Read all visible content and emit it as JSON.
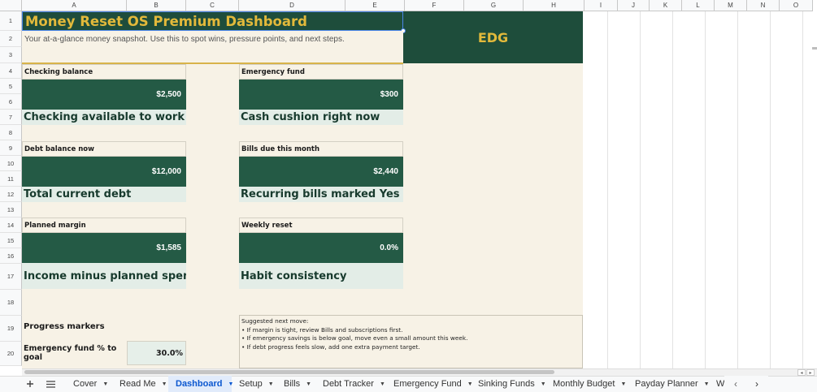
{
  "columns": [
    "A",
    "B",
    "C",
    "D",
    "E",
    "F",
    "G",
    "H",
    "I",
    "J",
    "K",
    "L",
    "M",
    "N",
    "O"
  ],
  "rows": [
    "1",
    "2",
    "3",
    "4",
    "5",
    "6",
    "7",
    "8",
    "9",
    "10",
    "11",
    "12",
    "13",
    "14",
    "15",
    "16",
    "17",
    "18",
    "19",
    "20"
  ],
  "header": {
    "title": "Money Reset OS Premium Dashboard",
    "subtitle": "Your at-a-glance money snapshot. Use this to spot wins, pressure points, and next steps.",
    "brand": "EDG"
  },
  "cards": [
    {
      "label": "Checking balance",
      "value": "$2,500",
      "caption": "Checking available to work with"
    },
    {
      "label": "Emergency fund",
      "value": "$300",
      "caption": "Cash cushion right now"
    },
    {
      "label": "Debt balance now",
      "value": "$12,000",
      "caption": "Total current debt"
    },
    {
      "label": "Bills due this month",
      "value": "$2,440",
      "caption": "Recurring bills marked Yes"
    },
    {
      "label": "Planned margin",
      "value": "$1,585",
      "caption": "Income minus planned spend"
    },
    {
      "label": "Weekly reset",
      "value": "0.0%",
      "caption": "Habit consistency"
    }
  ],
  "progress": {
    "heading": "Progress markers",
    "rows": [
      {
        "label": "Emergency fund % to goal",
        "value": "30.0%"
      }
    ]
  },
  "suggestion": {
    "heading": "Suggested next move:",
    "lines": [
      "• If margin is tight, review Bills and subscriptions first.",
      "• If emergency savings is below goal, move even a small amount this week.",
      "• If debt progress feels slow, add one extra payment target."
    ]
  },
  "tabs": [
    {
      "label": "Cover",
      "active": false
    },
    {
      "label": "Read Me",
      "active": false
    },
    {
      "label": "Dashboard",
      "active": true
    },
    {
      "label": "Setup",
      "active": false
    },
    {
      "label": "Bills",
      "active": false
    },
    {
      "label": "Debt Tracker",
      "active": false
    },
    {
      "label": "Emergency Fund",
      "active": false
    },
    {
      "label": "Sinking Funds",
      "active": false
    },
    {
      "label": "Monthly Budget",
      "active": false
    },
    {
      "label": "Payday Planner",
      "active": false
    },
    {
      "label": "W",
      "active": false
    }
  ],
  "colors": {
    "dark_green": "#1e4d3b",
    "card_green": "#245a45",
    "gold": "#e2b93b",
    "cream": "#f7f2e6",
    "mint": "#e3ede7",
    "active_tab": "#0b57d0"
  },
  "icons": {
    "add_sheet": "plus-icon",
    "all_sheets": "menu-icon",
    "tab_menu": "caret-down-icon",
    "scroll_prev": "chevron-left-icon",
    "scroll_next": "chevron-right-icon"
  }
}
